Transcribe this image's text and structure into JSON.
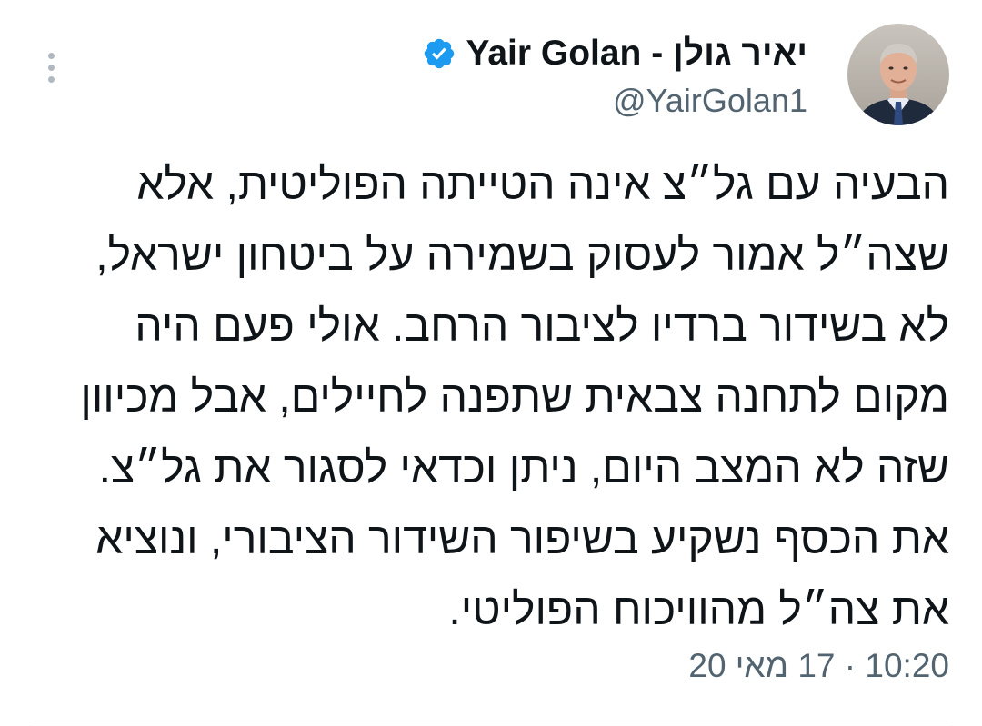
{
  "tweet": {
    "author": {
      "display_name": "Yair Golan - יאיר גולן",
      "handle": "@YairGolan1",
      "verified": true,
      "avatar_icon": "profile-photo"
    },
    "text_lines": [
      "הבעיה עם גל״צ אינה הטייתה הפוליטית, אלא",
      "שצה״ל אמור לעסוק בשמירה על ביטחון ישראל,",
      "לא בשידור ברדיו לציבור הרחב. אולי פעם היה",
      "מקום לתחנה צבאית שתפנה לחיילים, אבל מכיוון",
      "שזה לא המצב היום, ניתן וכדאי לסגור את גל״צ.",
      "את הכסף נשקיע בשיפור השידור הציבורי, ונוציא",
      "את צה״ל מהוויכוח הפוליטי."
    ],
    "timestamp": "10:20 · 17 מאי 20",
    "more_icon": "more-vertical-icon",
    "colors": {
      "verified": "#1d9bf0",
      "secondary_text": "#536471",
      "primary_text": "#0f1419"
    }
  }
}
